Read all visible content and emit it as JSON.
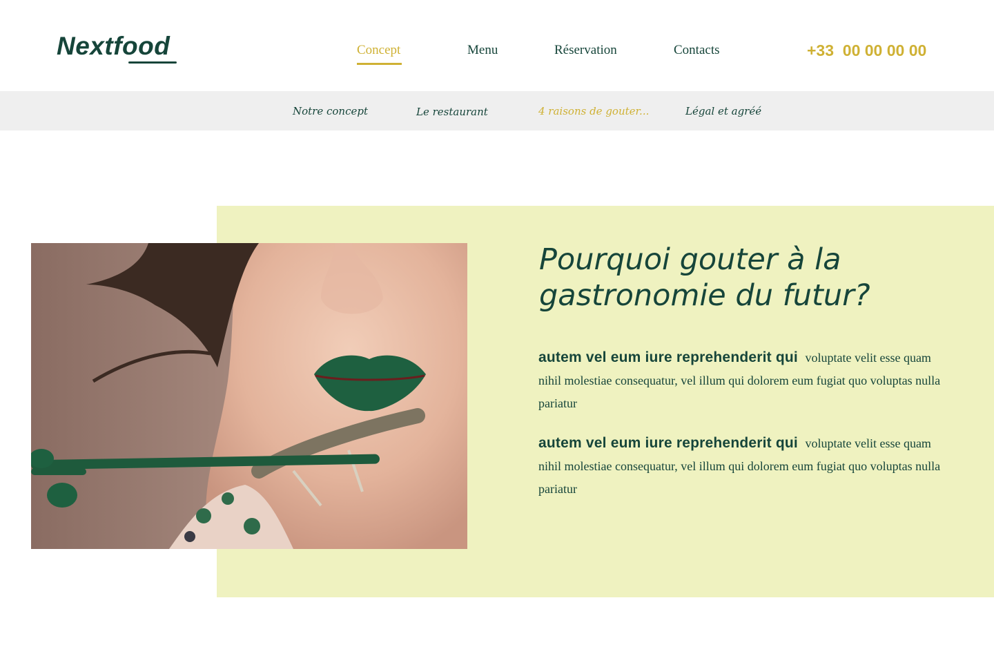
{
  "brand": {
    "name": "Nextfood"
  },
  "nav": {
    "items": [
      {
        "label": "Concept",
        "active": true
      },
      {
        "label": "Menu",
        "active": false
      },
      {
        "label": "Réservation",
        "active": false
      },
      {
        "label": "Contacts",
        "active": false
      }
    ],
    "phone": "+33  00 00 00 00"
  },
  "subnav": {
    "items": [
      {
        "label": "Notre concept",
        "active": false
      },
      {
        "label": "Le restaurant",
        "active": false
      },
      {
        "label": "4 raisons de gouter...",
        "active": true
      },
      {
        "label": "Légal et agréé",
        "active": false
      }
    ]
  },
  "content": {
    "title": "Pourquoi gouter à la gastronomie du futur?",
    "paragraphs": [
      {
        "lead": "autem vel eum iure reprehenderit qui",
        "text": "voluptate velit esse quam nihil molestiae consequatur, vel illum qui dolorem eum fugiat quo voluptas nulla pariatur"
      },
      {
        "lead": "autem vel eum iure reprehenderit qui",
        "text": "voluptate velit esse quam nihil molestiae consequatur, vel illum qui dolorem eum fugiat quo voluptas nulla pariatur"
      }
    ]
  },
  "colors": {
    "primary_green": "#16453a",
    "accent_gold": "#cfb134",
    "panel_bg": "#eff2c0",
    "subnav_bg": "#efefef"
  }
}
